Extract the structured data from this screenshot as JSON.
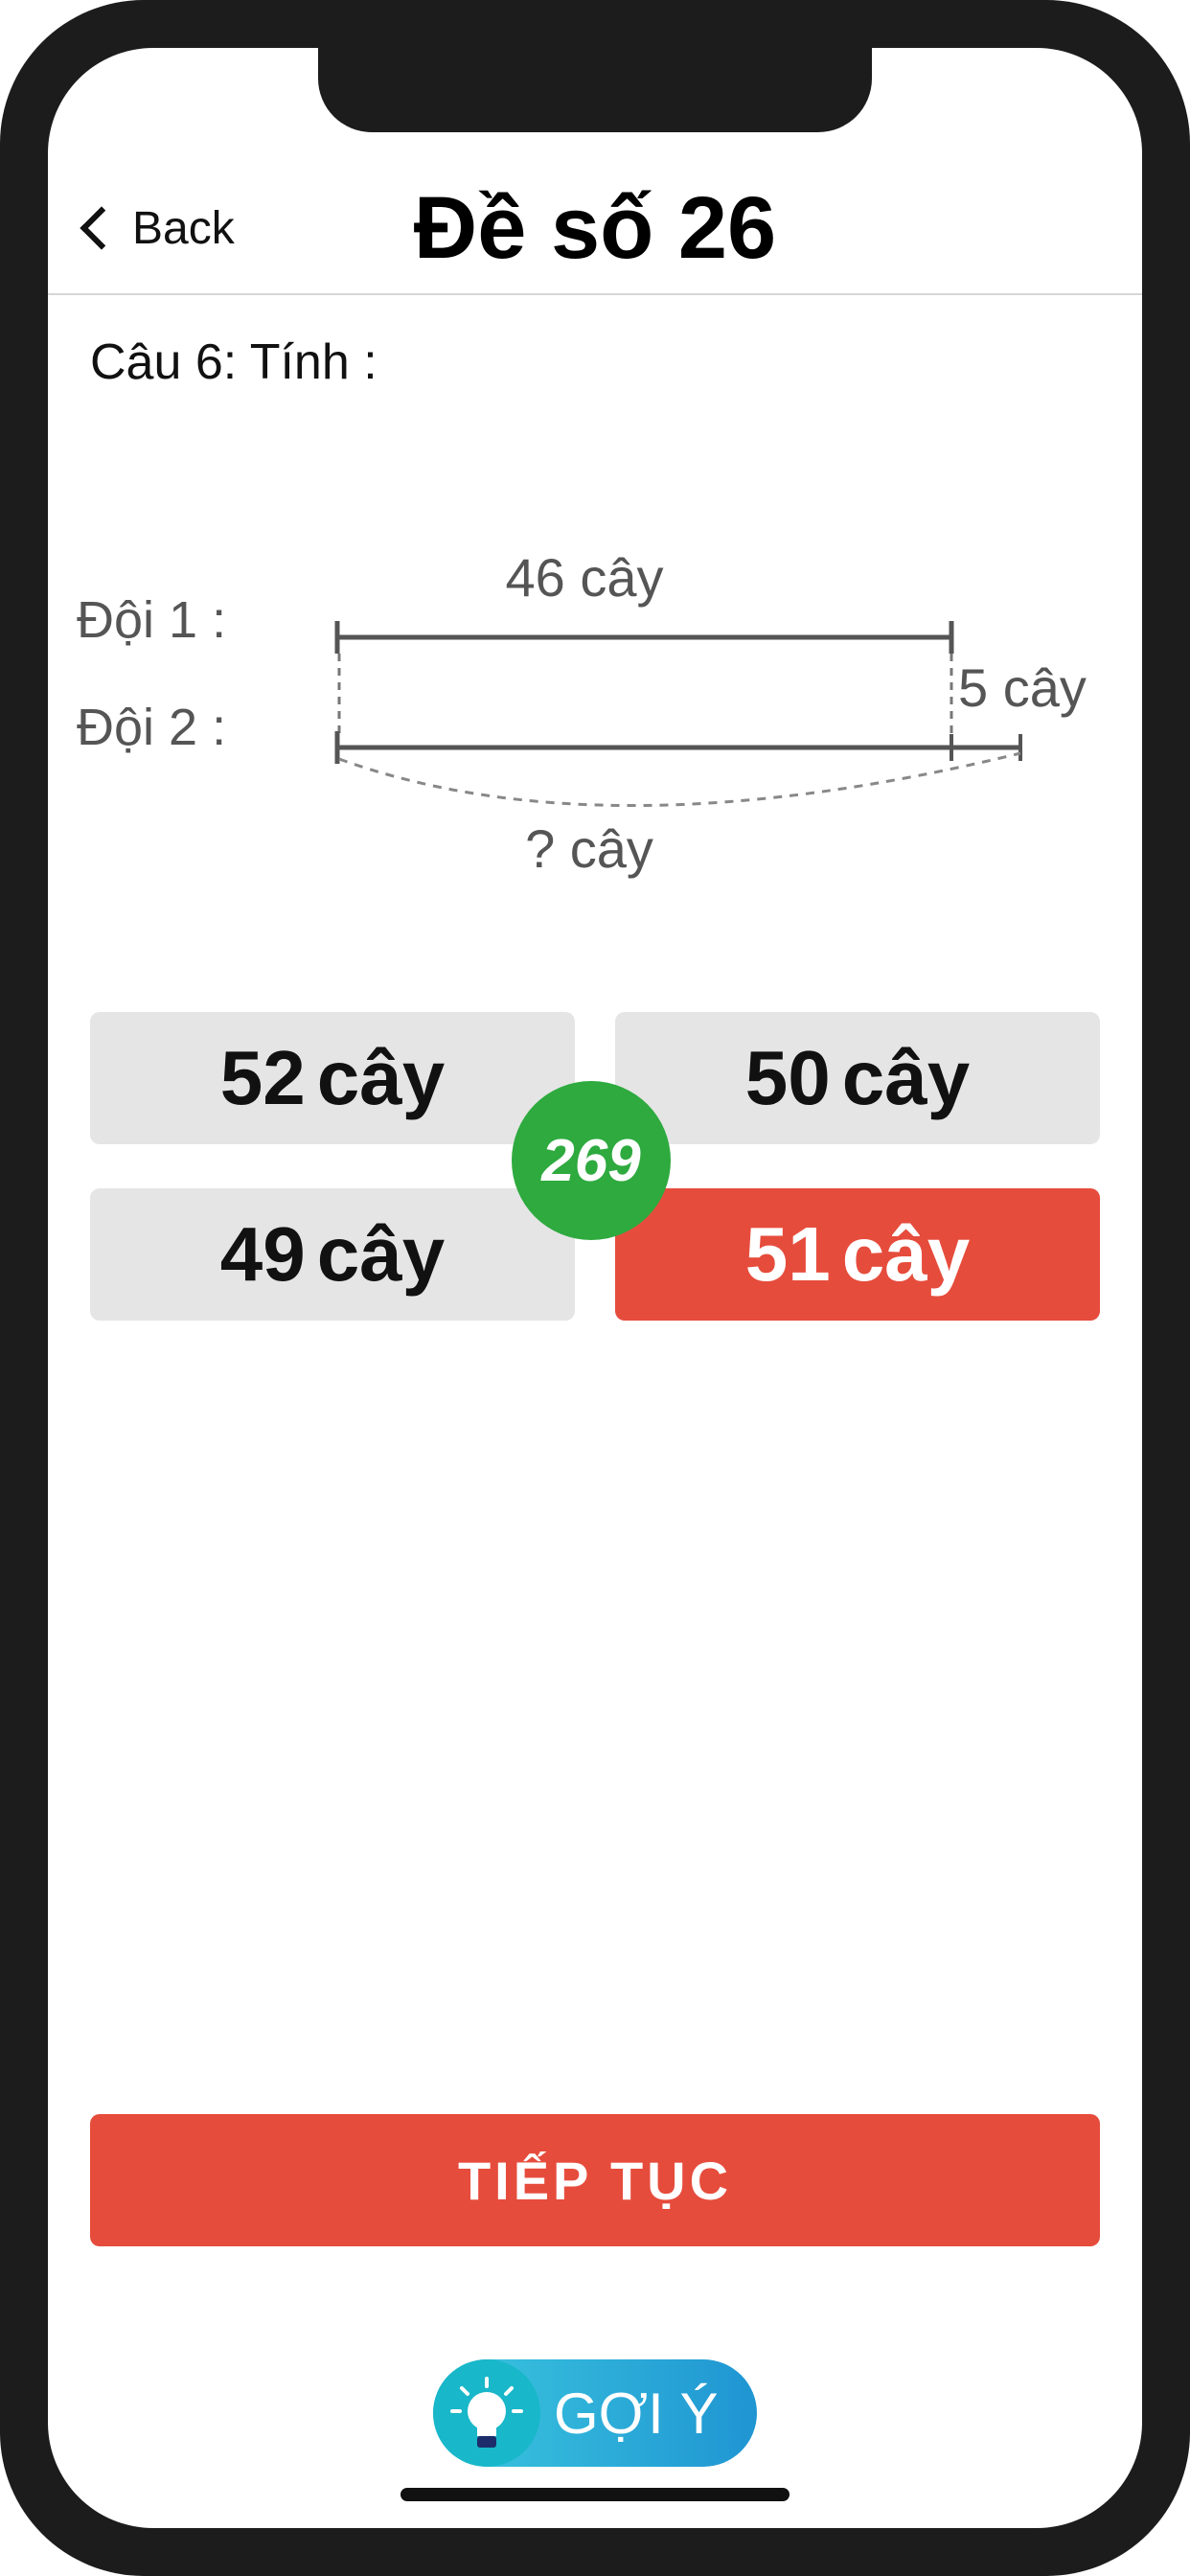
{
  "header": {
    "back_label": "Back",
    "title": "Đề số 26"
  },
  "question": {
    "text": "Câu 6: Tính :"
  },
  "diagram": {
    "team1_label": "Đội 1 :",
    "team2_label": "Đội 2 :",
    "top_value": "46 cây",
    "extra_value": "5 cây",
    "unknown_value": "? cây"
  },
  "answers": [
    {
      "value": "52",
      "unit": "cây",
      "selected": false
    },
    {
      "value": "50",
      "unit": "cây",
      "selected": false
    },
    {
      "value": "49",
      "unit": "cây",
      "selected": false
    },
    {
      "value": "51",
      "unit": "cây",
      "selected": true
    }
  ],
  "score_badge": "269",
  "continue_label": "TIẾP TỤC",
  "hint_label": "GỢI Ý",
  "colors": {
    "accent_red": "#e64c3c",
    "badge_green": "#2eaa3f",
    "hint_blue": "#1f95d2",
    "option_gray": "#e5e5e5"
  },
  "icons": {
    "back": "chevron-left-icon",
    "hint": "lightbulb-icon"
  }
}
